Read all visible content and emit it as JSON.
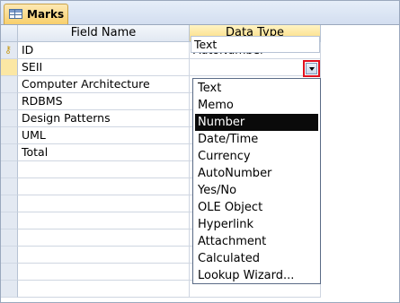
{
  "tab": {
    "label": "Marks",
    "icon": "table-icon"
  },
  "grid": {
    "headers": [
      "Field Name",
      "Data Type"
    ],
    "rows": [
      {
        "field": "ID",
        "type": "AutoNumber",
        "key": true
      },
      {
        "field": "SEII",
        "type": "Text",
        "current": true
      },
      {
        "field": "Computer Architecture",
        "type": ""
      },
      {
        "field": "RDBMS",
        "type": ""
      },
      {
        "field": "Design Patterns",
        "type": ""
      },
      {
        "field": "UML",
        "type": ""
      },
      {
        "field": "Total",
        "type": ""
      }
    ]
  },
  "combo": {
    "value": "Text",
    "icon": "chevron-down-icon"
  },
  "dropdown": {
    "options": [
      "Text",
      "Memo",
      "Number",
      "Date/Time",
      "Currency",
      "AutoNumber",
      "Yes/No",
      "OLE Object",
      "Hyperlink",
      "Attachment",
      "Calculated",
      "Lookup Wizard..."
    ],
    "selected": "Number"
  },
  "colors": {
    "highlight_border": "#e0101e",
    "selected_bg": "#0a0a0a",
    "active_header": "#fbdc7e"
  }
}
